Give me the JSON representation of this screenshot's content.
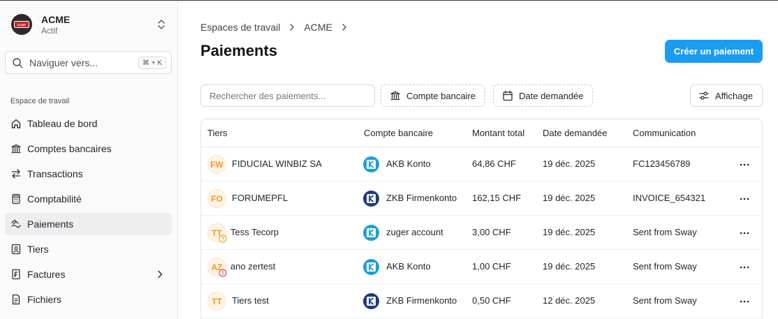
{
  "org": {
    "name": "ACME",
    "status": "Actif",
    "logo_text": "ACME"
  },
  "nav_search": {
    "label": "Naviguer vers...",
    "shortcut": "⌘ + K"
  },
  "sidebar": {
    "section_label": "Espace de travail",
    "items": [
      {
        "label": "Tableau de bord",
        "icon": "home-icon"
      },
      {
        "label": "Comptes bancaires",
        "icon": "bank-icon"
      },
      {
        "label": "Transactions",
        "icon": "arrows-icon"
      },
      {
        "label": "Comptabilité",
        "icon": "calculator-icon"
      },
      {
        "label": "Paiements",
        "icon": "payments-icon",
        "active": true
      },
      {
        "label": "Tiers",
        "icon": "contact-icon"
      },
      {
        "label": "Factures",
        "icon": "invoice-icon",
        "has_submenu": true
      },
      {
        "label": "Fichiers",
        "icon": "file-icon"
      }
    ]
  },
  "breadcrumb": [
    "Espaces de travail",
    "ACME"
  ],
  "page": {
    "title": "Paiements",
    "create_button": "Créer un paiement"
  },
  "toolbar": {
    "search_placeholder": "Rechercher des paiements...",
    "filter_bank": "Compte bancaire",
    "filter_date": "Date demandée",
    "view_button": "Affichage"
  },
  "table": {
    "columns": [
      "Tiers",
      "Compte bancaire",
      "Montant total",
      "Date demandée",
      "Communication"
    ],
    "rows": [
      {
        "initials": "FW",
        "tiers": "FIDUCIAL WINBIZ SA",
        "bank": "AKB Konto",
        "bank_type": "akb",
        "amount": "64,86 CHF",
        "date": "19 déc. 2025",
        "communication": "FC123456789",
        "badge": ""
      },
      {
        "initials": "FO",
        "tiers": "FORUMEPFL",
        "bank": "ZKB Firmenkonto",
        "bank_type": "zkb",
        "amount": "162,15 CHF",
        "date": "19 déc. 2025",
        "communication": "INVOICE_654321",
        "badge": ""
      },
      {
        "initials": "TT",
        "tiers": "Tess Tecorp",
        "bank": "zuger account",
        "bank_type": "akb",
        "amount": "3,00 CHF",
        "date": "19 déc. 2025",
        "communication": "Sent from Sway",
        "badge": "question"
      },
      {
        "initials": "AZ",
        "tiers": "ano zertest",
        "bank": "AKB Konto",
        "bank_type": "akb",
        "amount": "1,00 CHF",
        "date": "19 déc. 2025",
        "communication": "Sent from Sway",
        "badge": "warning"
      },
      {
        "initials": "TT",
        "tiers": "Tiers test",
        "bank": "ZKB Firmenkonto",
        "bank_type": "zkb",
        "amount": "0,50 CHF",
        "date": "12 déc. 2025",
        "communication": "Sent from Sway",
        "badge": ""
      }
    ]
  },
  "colors": {
    "accent": "#1a9cf0",
    "akb": "#1aa0d8",
    "zkb": "#1c3c7c",
    "avatar_text": "#f29a1f",
    "warning": "#e5484d",
    "question": "#e8a317"
  }
}
